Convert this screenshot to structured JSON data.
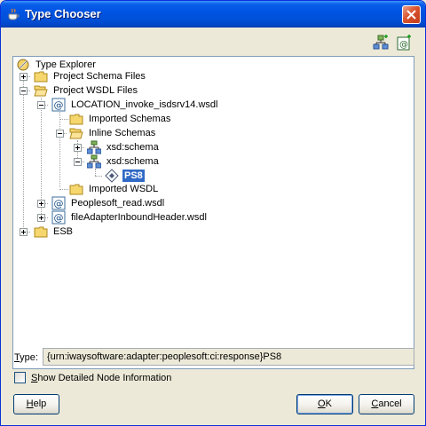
{
  "window": {
    "title": "Type Chooser"
  },
  "toolbar": {
    "icons": [
      "add-schema-icon",
      "add-wsdl-icon"
    ]
  },
  "tree": {
    "root": "Type Explorer",
    "items": [
      "Project Schema Files",
      "Project WSDL Files",
      "LOCATION_invoke_isdsrv14.wsdl",
      "Imported Schemas",
      "Inline Schemas",
      "xsd:schema",
      "xsd:schema",
      "PS8",
      "Imported WSDL",
      "Peoplesoft_read.wsdl",
      "fileAdapterInboundHeader.wsdl",
      "ESB"
    ]
  },
  "type_field": {
    "label_mnemonic": "T",
    "label_rest": "ype:",
    "value": "{urn:iwaysoftware:adapter:peoplesoft:ci:response}PS8"
  },
  "checkbox": {
    "label_mnemonic": "S",
    "label_rest": "how Detailed Node Information",
    "checked": false
  },
  "buttons": {
    "help_mnemonic": "H",
    "help_rest": "elp",
    "ok_mnemonic": "O",
    "ok_rest": "K",
    "cancel_mnemonic": "C",
    "cancel_rest": "ancel"
  },
  "colors": {
    "selection": "#316ac5",
    "titlebar": "#0054e3",
    "dialog_bg": "#ece9d8"
  }
}
